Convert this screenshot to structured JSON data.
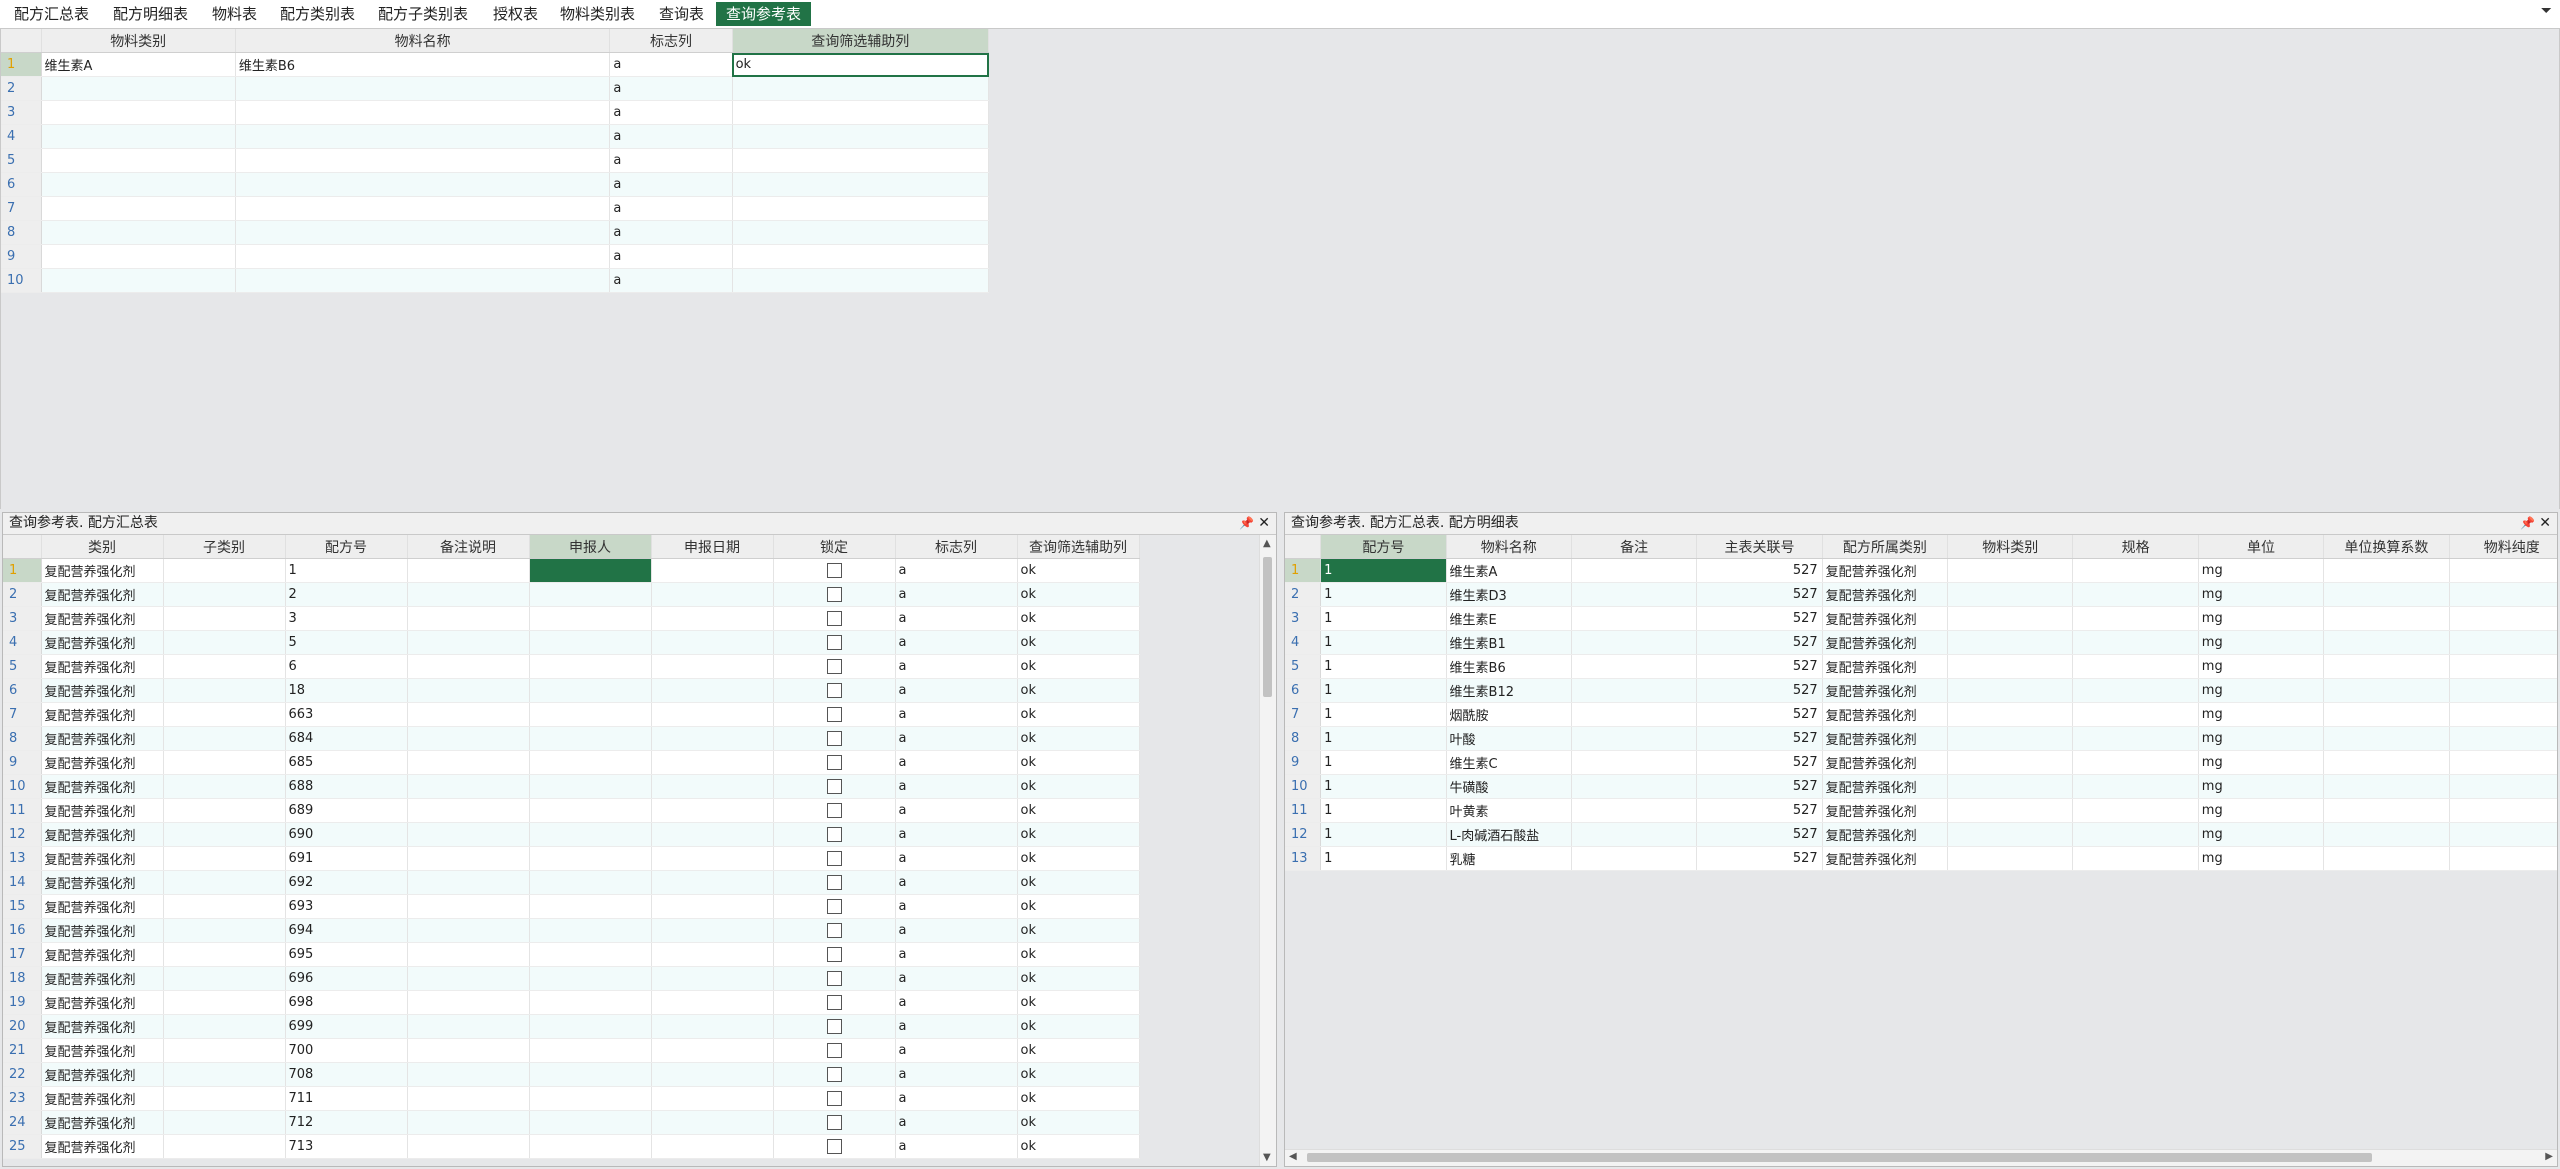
{
  "tabs": [
    {
      "label": "配方汇总表",
      "active": false
    },
    {
      "label": "配方明细表",
      "active": false
    },
    {
      "label": "物料表",
      "active": false
    },
    {
      "label": "配方类别表",
      "active": false
    },
    {
      "label": "配方子类别表",
      "active": false
    },
    {
      "label": "授权表",
      "active": false
    },
    {
      "label": "物料类别表",
      "active": false
    },
    {
      "label": "查询表",
      "active": false
    },
    {
      "label": "查询参考表",
      "active": true
    }
  ],
  "tab_scroll_icon": "chevron-down-icon",
  "top_grid": {
    "columns": [
      "物料类别",
      "物料名称",
      "标志列",
      "查询筛选辅助列"
    ],
    "rows": [
      {
        "n": "1",
        "c1": "维生素A",
        "c2": "维生素B6",
        "c3": "a",
        "c4": "ok"
      },
      {
        "n": "2",
        "c1": "",
        "c2": "",
        "c3": "a",
        "c4": ""
      },
      {
        "n": "3",
        "c1": "",
        "c2": "",
        "c3": "a",
        "c4": ""
      },
      {
        "n": "4",
        "c1": "",
        "c2": "",
        "c3": "a",
        "c4": ""
      },
      {
        "n": "5",
        "c1": "",
        "c2": "",
        "c3": "a",
        "c4": ""
      },
      {
        "n": "6",
        "c1": "",
        "c2": "",
        "c3": "a",
        "c4": ""
      },
      {
        "n": "7",
        "c1": "",
        "c2": "",
        "c3": "a",
        "c4": ""
      },
      {
        "n": "8",
        "c1": "",
        "c2": "",
        "c3": "a",
        "c4": ""
      },
      {
        "n": "9",
        "c1": "",
        "c2": "",
        "c3": "a",
        "c4": ""
      },
      {
        "n": "10",
        "c1": "",
        "c2": "",
        "c3": "a",
        "c4": ""
      }
    ]
  },
  "left_panel": {
    "title": "查询参考表. 配方汇总表",
    "pin_icon": "pin-icon",
    "close_icon": "close-icon",
    "columns": [
      "类别",
      "子类别",
      "配方号",
      "备注说明",
      "申报人",
      "申报日期",
      "锁定",
      "标志列",
      "查询筛选辅助列"
    ],
    "rows": [
      {
        "n": "1",
        "cat": "复配营养强化剂",
        "no": "1",
        "flag": "a",
        "aux": "ok"
      },
      {
        "n": "2",
        "cat": "复配营养强化剂",
        "no": "2",
        "flag": "a",
        "aux": "ok"
      },
      {
        "n": "3",
        "cat": "复配营养强化剂",
        "no": "3",
        "flag": "a",
        "aux": "ok"
      },
      {
        "n": "4",
        "cat": "复配营养强化剂",
        "no": "5",
        "flag": "a",
        "aux": "ok"
      },
      {
        "n": "5",
        "cat": "复配营养强化剂",
        "no": "6",
        "flag": "a",
        "aux": "ok"
      },
      {
        "n": "6",
        "cat": "复配营养强化剂",
        "no": "18",
        "flag": "a",
        "aux": "ok"
      },
      {
        "n": "7",
        "cat": "复配营养强化剂",
        "no": "663",
        "flag": "a",
        "aux": "ok"
      },
      {
        "n": "8",
        "cat": "复配营养强化剂",
        "no": "684",
        "flag": "a",
        "aux": "ok"
      },
      {
        "n": "9",
        "cat": "复配营养强化剂",
        "no": "685",
        "flag": "a",
        "aux": "ok"
      },
      {
        "n": "10",
        "cat": "复配营养强化剂",
        "no": "688",
        "flag": "a",
        "aux": "ok"
      },
      {
        "n": "11",
        "cat": "复配营养强化剂",
        "no": "689",
        "flag": "a",
        "aux": "ok"
      },
      {
        "n": "12",
        "cat": "复配营养强化剂",
        "no": "690",
        "flag": "a",
        "aux": "ok"
      },
      {
        "n": "13",
        "cat": "复配营养强化剂",
        "no": "691",
        "flag": "a",
        "aux": "ok"
      },
      {
        "n": "14",
        "cat": "复配营养强化剂",
        "no": "692",
        "flag": "a",
        "aux": "ok"
      },
      {
        "n": "15",
        "cat": "复配营养强化剂",
        "no": "693",
        "flag": "a",
        "aux": "ok"
      },
      {
        "n": "16",
        "cat": "复配营养强化剂",
        "no": "694",
        "flag": "a",
        "aux": "ok"
      },
      {
        "n": "17",
        "cat": "复配营养强化剂",
        "no": "695",
        "flag": "a",
        "aux": "ok"
      },
      {
        "n": "18",
        "cat": "复配营养强化剂",
        "no": "696",
        "flag": "a",
        "aux": "ok"
      },
      {
        "n": "19",
        "cat": "复配营养强化剂",
        "no": "698",
        "flag": "a",
        "aux": "ok"
      },
      {
        "n": "20",
        "cat": "复配营养强化剂",
        "no": "699",
        "flag": "a",
        "aux": "ok"
      },
      {
        "n": "21",
        "cat": "复配营养强化剂",
        "no": "700",
        "flag": "a",
        "aux": "ok"
      },
      {
        "n": "22",
        "cat": "复配营养强化剂",
        "no": "708",
        "flag": "a",
        "aux": "ok"
      },
      {
        "n": "23",
        "cat": "复配营养强化剂",
        "no": "711",
        "flag": "a",
        "aux": "ok"
      },
      {
        "n": "24",
        "cat": "复配营养强化剂",
        "no": "712",
        "flag": "a",
        "aux": "ok"
      },
      {
        "n": "25",
        "cat": "复配营养强化剂",
        "no": "713",
        "flag": "a",
        "aux": "ok"
      }
    ]
  },
  "right_panel": {
    "title": "查询参考表. 配方汇总表. 配方明细表",
    "pin_icon": "pin-icon",
    "close_icon": "close-icon",
    "columns": [
      "配方号",
      "物料名称",
      "备注",
      "主表关联号",
      "配方所属类别",
      "物料类别",
      "规格",
      "单位",
      "单位换算系数",
      "物料纯度"
    ],
    "rows": [
      {
        "n": "1",
        "no": "1",
        "name": "维生素A",
        "link": "527",
        "cat": "复配营养强化剂",
        "unit": "mg"
      },
      {
        "n": "2",
        "no": "1",
        "name": "维生素D3",
        "link": "527",
        "cat": "复配营养强化剂",
        "unit": "mg"
      },
      {
        "n": "3",
        "no": "1",
        "name": "维生素E",
        "link": "527",
        "cat": "复配营养强化剂",
        "unit": "mg"
      },
      {
        "n": "4",
        "no": "1",
        "name": "维生素B1",
        "link": "527",
        "cat": "复配营养强化剂",
        "unit": "mg"
      },
      {
        "n": "5",
        "no": "1",
        "name": "维生素B6",
        "link": "527",
        "cat": "复配营养强化剂",
        "unit": "mg"
      },
      {
        "n": "6",
        "no": "1",
        "name": "维生素B12",
        "link": "527",
        "cat": "复配营养强化剂",
        "unit": "mg"
      },
      {
        "n": "7",
        "no": "1",
        "name": "烟酰胺",
        "link": "527",
        "cat": "复配营养强化剂",
        "unit": "mg"
      },
      {
        "n": "8",
        "no": "1",
        "name": "叶酸",
        "link": "527",
        "cat": "复配营养强化剂",
        "unit": "mg"
      },
      {
        "n": "9",
        "no": "1",
        "name": "维生素C",
        "link": "527",
        "cat": "复配营养强化剂",
        "unit": "mg"
      },
      {
        "n": "10",
        "no": "1",
        "name": "牛磺酸",
        "link": "527",
        "cat": "复配营养强化剂",
        "unit": "mg"
      },
      {
        "n": "11",
        "no": "1",
        "name": "叶黄素",
        "link": "527",
        "cat": "复配营养强化剂",
        "unit": "mg"
      },
      {
        "n": "12",
        "no": "1",
        "name": "L-肉碱酒石酸盐",
        "link": "527",
        "cat": "复配营养强化剂",
        "unit": "mg"
      },
      {
        "n": "13",
        "no": "1",
        "name": "乳糖",
        "link": "527",
        "cat": "复配营养强化剂",
        "unit": "mg"
      }
    ]
  },
  "colors": {
    "accent": "#217346",
    "grid_alt": "#f2fbfb",
    "row_number": "#3a6fb0",
    "current_row_marker": "#e0a000"
  }
}
